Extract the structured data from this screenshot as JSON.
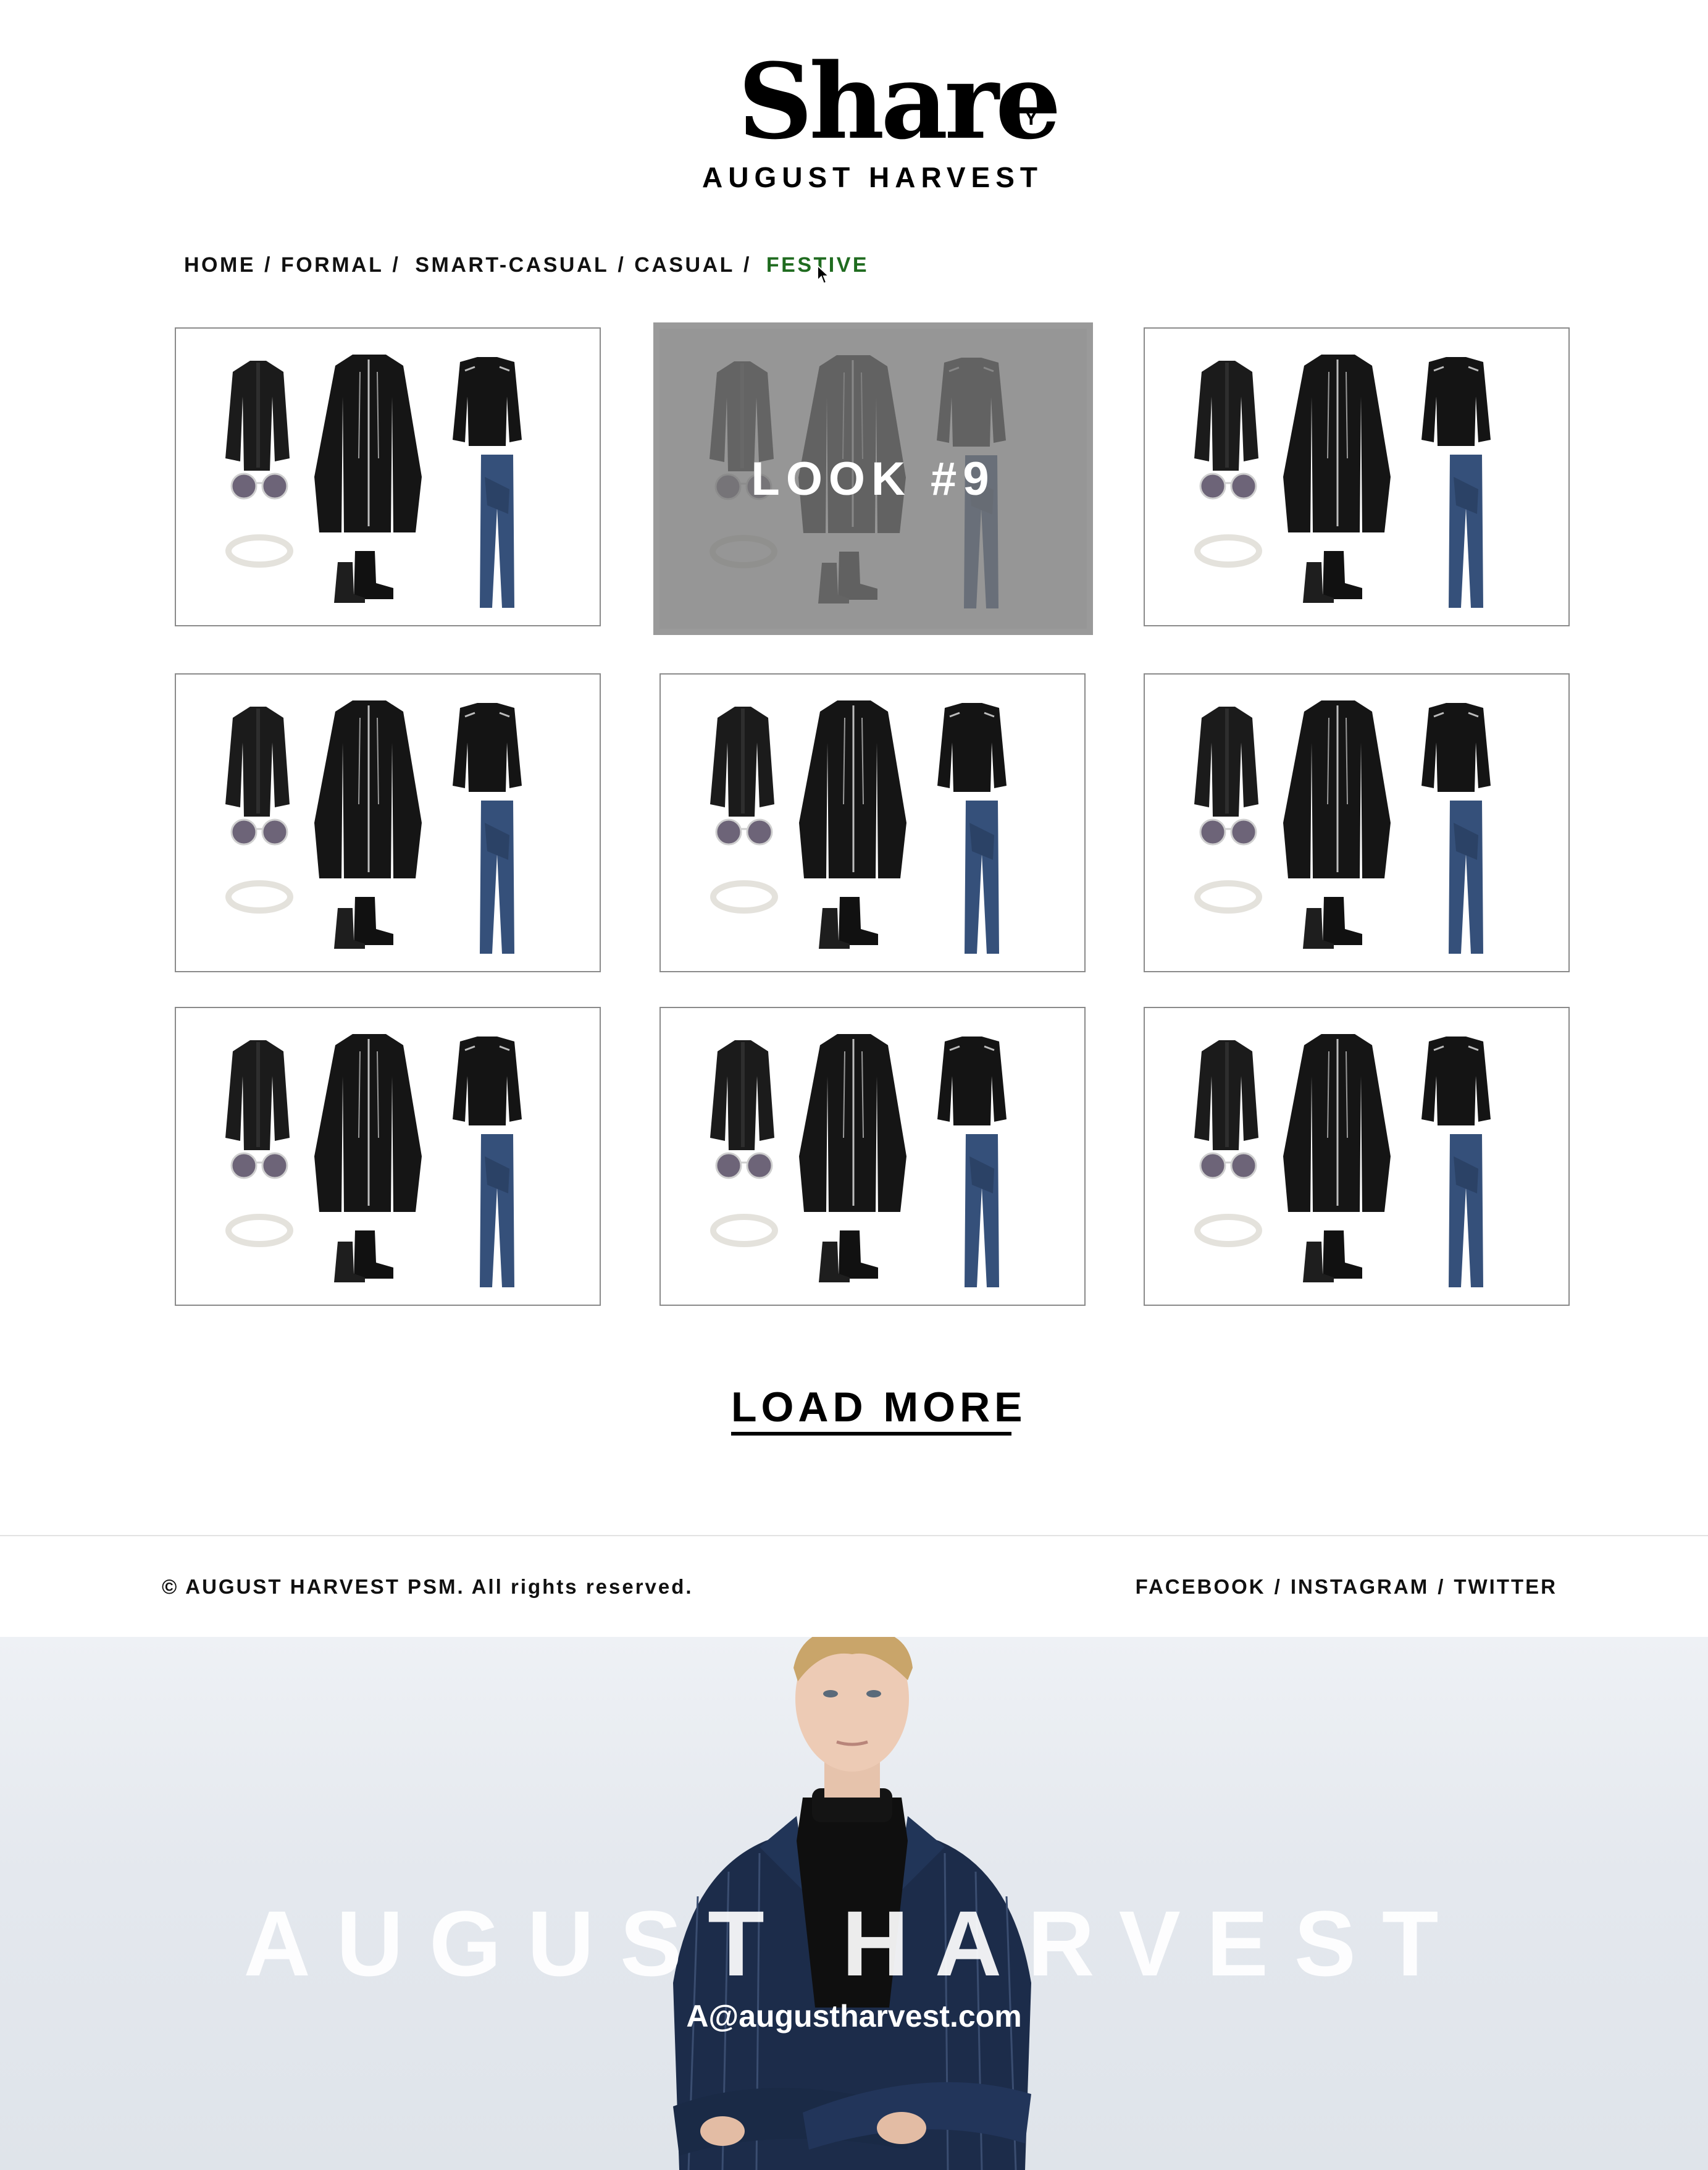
{
  "brand": {
    "title": "Share",
    "by": "BY",
    "subtitle": "AUGUST HARVEST"
  },
  "breadcrumb": {
    "items": [
      "HOME",
      "FORMAL",
      "SMART-CASUAL",
      "CASUAL",
      "FESTIVE"
    ],
    "separator": "/",
    "active": "FESTIVE",
    "active_color": "#1f6b1f"
  },
  "looks": {
    "hover_label": "LOOK #9",
    "items": [
      {
        "icon": "outfit-collage"
      },
      {
        "icon": "outfit-collage",
        "hovered": true
      },
      {
        "icon": "outfit-collage"
      },
      {
        "icon": "outfit-collage"
      },
      {
        "icon": "outfit-collage"
      },
      {
        "icon": "outfit-collage"
      },
      {
        "icon": "outfit-collage"
      },
      {
        "icon": "outfit-collage"
      },
      {
        "icon": "outfit-collage"
      }
    ]
  },
  "load_more": {
    "label": "LOAD MORE"
  },
  "footer": {
    "copyright": "© AUGUST HARVEST PSM. All rights reserved.",
    "social": [
      "FACEBOOK",
      "INSTAGRAM",
      "TWITTER"
    ],
    "separator": "/"
  },
  "hero": {
    "title": "AUGUST HARVEST",
    "email": "A@augustharvest.com"
  }
}
